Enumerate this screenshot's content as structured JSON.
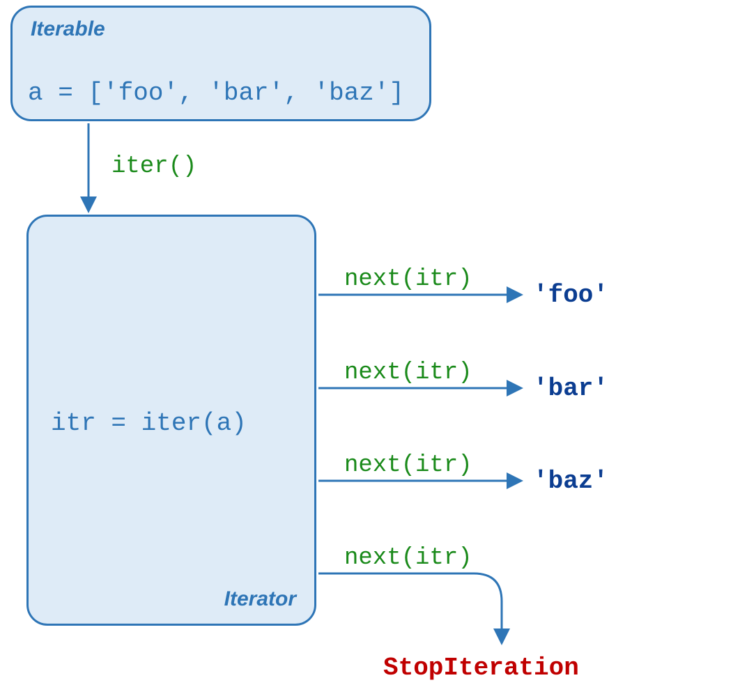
{
  "iterable": {
    "title": "Iterable",
    "code": "a = ['foo', 'bar', 'baz']"
  },
  "iter_call": "iter()",
  "iterator": {
    "title": "Iterator",
    "code": "itr = iter(a)"
  },
  "next_calls": [
    {
      "call": "next(itr)",
      "result": "'foo'"
    },
    {
      "call": "next(itr)",
      "result": "'bar'"
    },
    {
      "call": "next(itr)",
      "result": "'baz'"
    },
    {
      "call": "next(itr)",
      "result": "StopIteration"
    }
  ]
}
